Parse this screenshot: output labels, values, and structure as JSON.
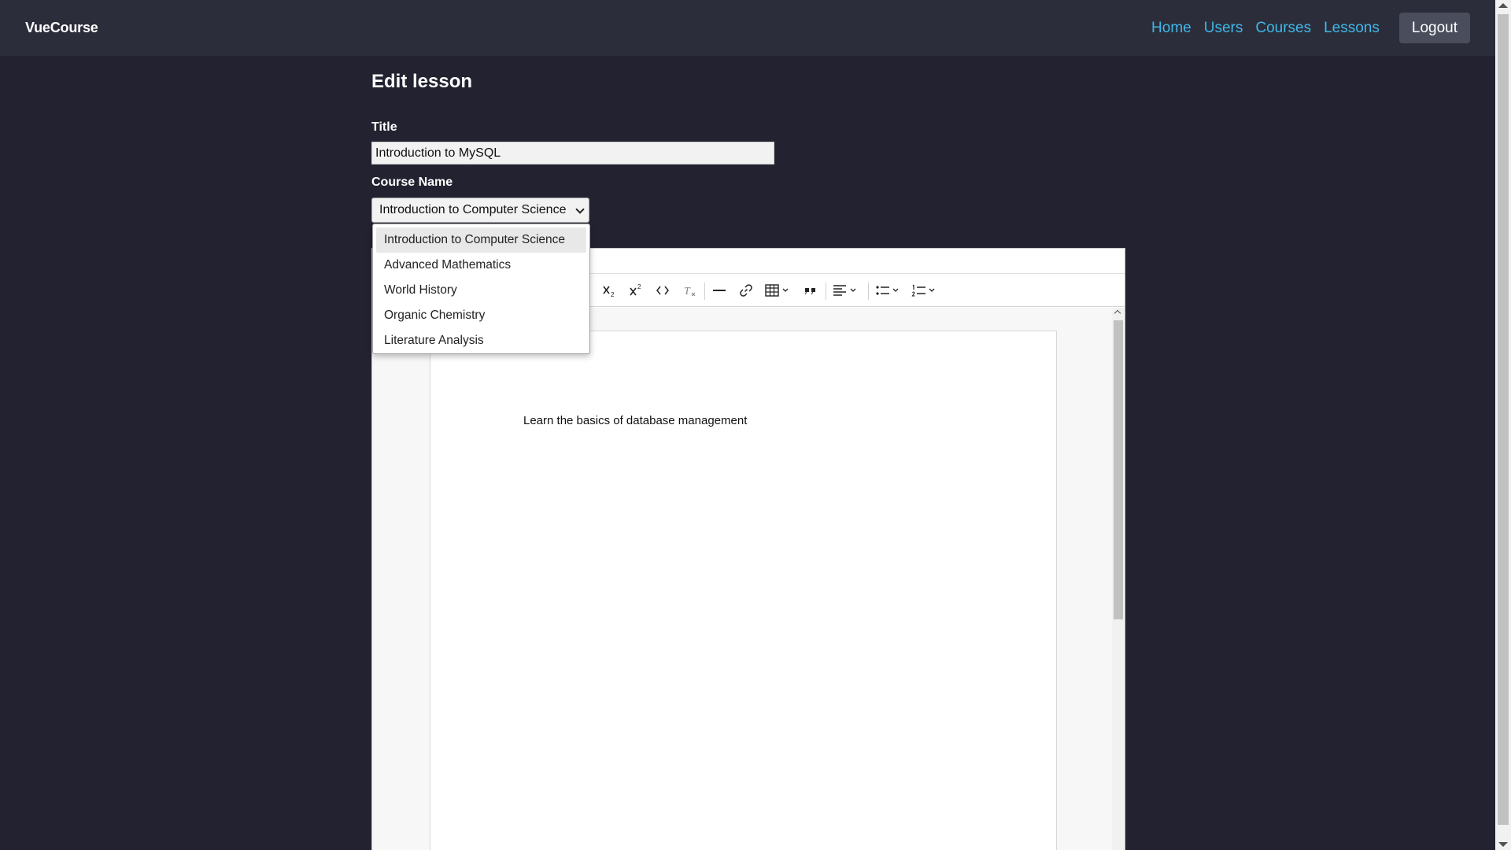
{
  "navbar": {
    "brand": "VueCourse",
    "links": [
      "Home",
      "Users",
      "Courses",
      "Lessons"
    ],
    "logout_label": "Logout"
  },
  "page": {
    "title": "Edit lesson"
  },
  "form": {
    "title_label": "Title",
    "title_value": "Introduction to MySQL",
    "course_label": "Course Name",
    "course_selected": "Introduction to Computer Science",
    "course_options": [
      "Introduction to Computer Science",
      "Advanced Mathematics",
      "World History",
      "Organic Chemistry",
      "Literature Analysis"
    ]
  },
  "editor": {
    "toolbar": [
      "subscript",
      "superscript",
      "code",
      "remove-format",
      "horizontal-line",
      "link",
      "table",
      "blockquote",
      "align",
      "bullet-list",
      "numbered-list"
    ],
    "content": "Learn the basics of database management"
  }
}
